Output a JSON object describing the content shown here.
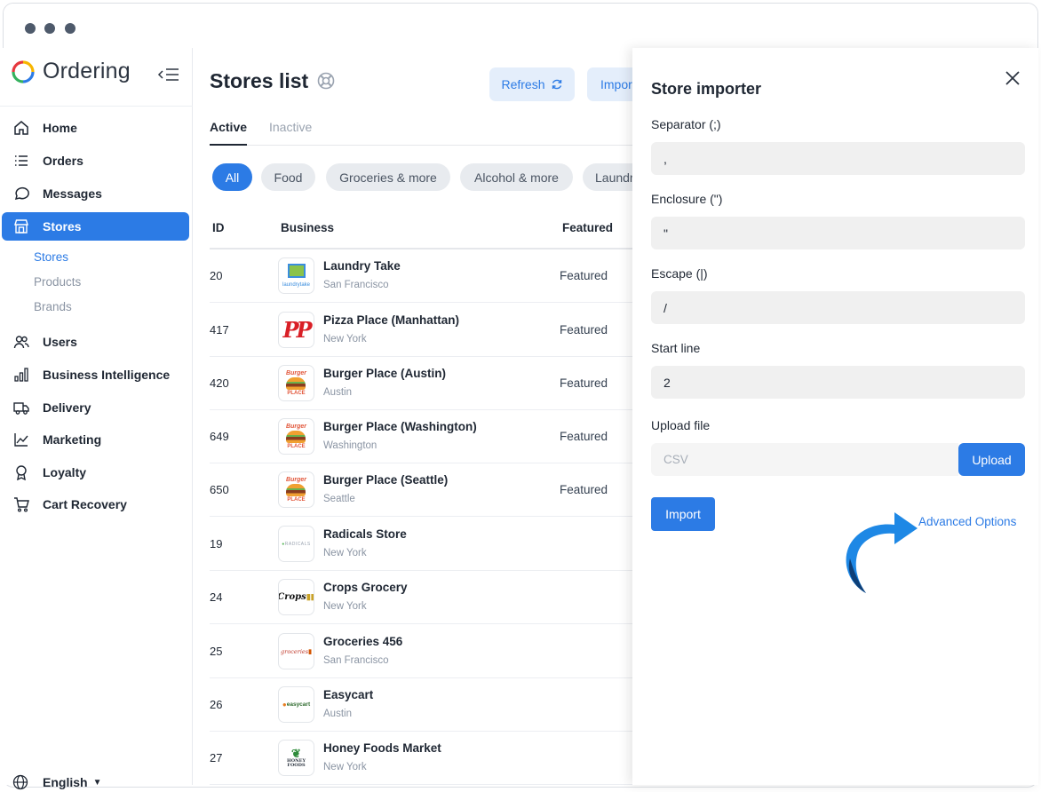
{
  "app": {
    "name": "Ordering"
  },
  "colors": {
    "accent": "#2c7be5",
    "arrow": "#1e88e5"
  },
  "sidebar": {
    "nav": [
      {
        "label": "Home",
        "icon": "home-icon"
      },
      {
        "label": "Orders",
        "icon": "list-icon"
      },
      {
        "label": "Messages",
        "icon": "chat-icon"
      },
      {
        "label": "Stores",
        "icon": "store-icon",
        "active": true
      },
      {
        "label": "Users",
        "icon": "users-icon"
      },
      {
        "label": "Business Intelligence",
        "icon": "bar-chart-icon"
      },
      {
        "label": "Delivery",
        "icon": "truck-icon"
      },
      {
        "label": "Marketing",
        "icon": "trend-icon"
      },
      {
        "label": "Loyalty",
        "icon": "award-icon"
      },
      {
        "label": "Cart Recovery",
        "icon": "cart-icon"
      }
    ],
    "stores_sub": [
      "Stores",
      "Products",
      "Brands"
    ],
    "language": "English"
  },
  "main": {
    "title": "Stores list",
    "refresh_label": "Refresh",
    "import_label": "Import",
    "tabs": [
      "Active",
      "Inactive"
    ],
    "chips": [
      "All",
      "Food",
      "Groceries & more",
      "Alcohol & more",
      "Laundry"
    ],
    "columns": {
      "id": "ID",
      "business": "Business",
      "featured": "Featured"
    },
    "rows": [
      {
        "id": "20",
        "name": "Laundry Take",
        "city": "San Francisco",
        "featured": "Featured",
        "logo": "laundry-logo"
      },
      {
        "id": "417",
        "name": "Pizza Place (Manhattan)",
        "city": "New York",
        "featured": "Featured",
        "logo": "pizza-logo"
      },
      {
        "id": "420",
        "name": "Burger Place (Austin)",
        "city": "Austin",
        "featured": "Featured",
        "logo": "burger-logo"
      },
      {
        "id": "649",
        "name": "Burger Place (Washington)",
        "city": "Washington",
        "featured": "Featured",
        "logo": "burger-logo"
      },
      {
        "id": "650",
        "name": "Burger Place (Seattle)",
        "city": "Seattle",
        "featured": "Featured",
        "logo": "burger-logo"
      },
      {
        "id": "19",
        "name": "Radicals Store",
        "city": "New York",
        "featured": "",
        "logo": "radicals-logo"
      },
      {
        "id": "24",
        "name": "Crops Grocery",
        "city": "New York",
        "featured": "",
        "logo": "crops-logo"
      },
      {
        "id": "25",
        "name": "Groceries 456",
        "city": "San Francisco",
        "featured": "",
        "logo": "groceries-logo"
      },
      {
        "id": "26",
        "name": "Easycart",
        "city": "Austin",
        "featured": "",
        "logo": "easycart-logo"
      },
      {
        "id": "27",
        "name": "Honey Foods Market",
        "city": "New York",
        "featured": "",
        "logo": "honey-logo"
      }
    ],
    "logo_text": {
      "laundry": "laundrytake",
      "pizza": "PP",
      "burger_top": "Burger",
      "burger_bottom": "PLACE",
      "radicals": "RADICALS",
      "crops": "Crops",
      "groceries": "groceries",
      "easycart": "easycart",
      "honey": "HONEY FOODS"
    }
  },
  "importer": {
    "title": "Store importer",
    "separator": {
      "label": "Separator (;)",
      "value": ","
    },
    "enclosure": {
      "label": "Enclosure (\")",
      "value": "\""
    },
    "escape": {
      "label": "Escape (|)",
      "value": "/"
    },
    "start_line": {
      "label": "Start line",
      "value": "2"
    },
    "upload_file": {
      "label": "Upload file",
      "placeholder": "CSV"
    },
    "upload_label": "Upload",
    "import_label": "Import",
    "advanced_label": "Advanced Options"
  }
}
